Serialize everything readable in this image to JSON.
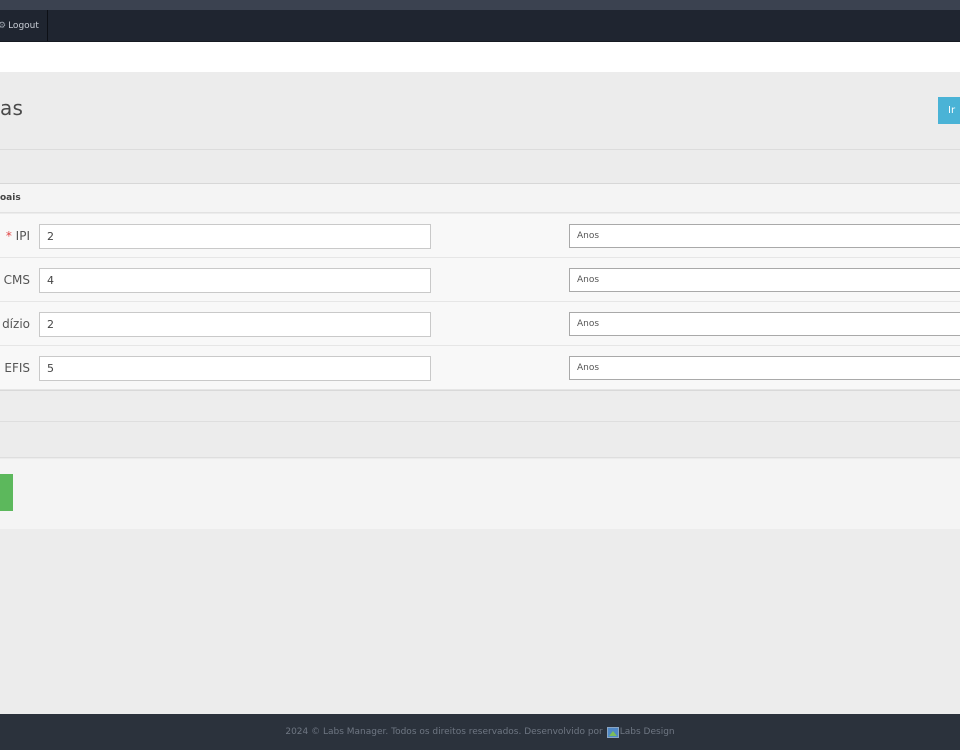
{
  "navbar": {
    "logout_icon": "gear-icon",
    "logout_icon_glyph": "⚙",
    "logout_label": "Logout"
  },
  "header": {
    "title_fragment": "as",
    "ir_button_label": "Ir"
  },
  "section": {
    "heading_fragment": "oais"
  },
  "rows": [
    {
      "label": "IPI",
      "required_mark": "*",
      "value": "2",
      "unit": "Anos"
    },
    {
      "label": "CMS",
      "value": "4",
      "unit": "Anos"
    },
    {
      "label": "dízio",
      "value": "2",
      "unit": "Anos"
    },
    {
      "label": "EFIS",
      "value": "5",
      "unit": "Anos"
    }
  ],
  "footer": {
    "text": "2024 © Labs Manager. Todos os direitos reservados. Desenvolvido por",
    "image_icon": "broken-image-icon",
    "image_alt": "Labs Design"
  },
  "colors": {
    "navbar": "#1f2530",
    "ir_button": "#4ab3d6",
    "save_button": "#5cb85c",
    "footer": "#2b323c",
    "required": "#e04343"
  }
}
